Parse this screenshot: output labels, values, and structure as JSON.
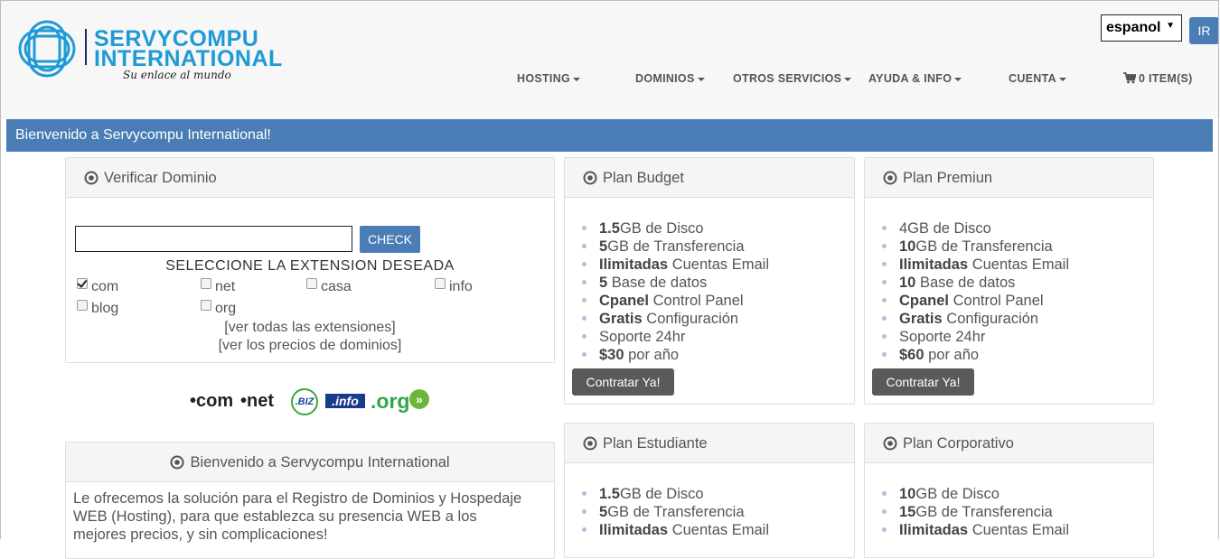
{
  "brand": {
    "line1": "SERVYCOMPU",
    "line2": "INTERNATIONAL",
    "tagline": "Su enlace al mundo",
    "color": "#1e9ad6"
  },
  "language": {
    "selected": "espanol",
    "go_label": "IR"
  },
  "nav": [
    {
      "label": "HOSTING"
    },
    {
      "label": "DOMINIOS"
    },
    {
      "label": "OTROS SERVICIOS"
    },
    {
      "label": "AYUDA & INFO"
    },
    {
      "label": "CUENTA"
    }
  ],
  "cart": {
    "label": "0 ITEM(S)",
    "icon": "cart-icon"
  },
  "welcome_bar": "Bienvenido a Servycompu International!",
  "domain_panel": {
    "title": "Verificar Dominio",
    "input_value": "",
    "check_label": "CHECK",
    "extension_title": "SELECCIONE LA EXTENSION DESEADA",
    "extensions": [
      {
        "label": "com",
        "checked": true
      },
      {
        "label": "net",
        "checked": false
      },
      {
        "label": "casa",
        "checked": false
      },
      {
        "label": "info",
        "checked": false
      },
      {
        "label": "blog",
        "checked": false
      },
      {
        "label": "org",
        "checked": false
      }
    ],
    "link_all": "[ver todas las extensiones]",
    "link_prices": "[ver los precios de dominios]"
  },
  "tld_logos": {
    "com": "•com",
    "net": "•net",
    "biz": ".BIZ",
    "info": ".info",
    "org": ".org"
  },
  "intro_panel": {
    "title": "Bienvenido a Servycompu International",
    "text": "Le ofrecemos la solución para el Registro de Dominios y Hospedaje WEB (Hosting), para que establezca su presencia WEB a los mejores precios, y sin complicaciones!"
  },
  "plans": [
    {
      "title": "Plan Budget",
      "features": [
        {
          "strong": "1.5",
          "rest": "GB de Disco"
        },
        {
          "strong": "5",
          "rest": "GB de Transferencia"
        },
        {
          "strong": "Ilimitadas",
          "rest": " Cuentas Email"
        },
        {
          "strong": "5",
          "rest": " Base de datos"
        },
        {
          "strong": "Cpanel",
          "rest": " Control Panel"
        },
        {
          "strong": "Gratis",
          "rest": " Configuración"
        },
        {
          "strong": "",
          "rest": "Soporte 24hr"
        },
        {
          "strong": "$30",
          "rest": " por año"
        }
      ],
      "button": "Contratar Ya!"
    },
    {
      "title": "Plan Premiun",
      "features": [
        {
          "strong": "",
          "rest": "4GB de Disco"
        },
        {
          "strong": "10",
          "rest": "GB de Transferencia"
        },
        {
          "strong": "Ilimitadas",
          "rest": " Cuentas Email"
        },
        {
          "strong": "10",
          "rest": " Base de datos"
        },
        {
          "strong": "Cpanel",
          "rest": " Control Panel"
        },
        {
          "strong": "Gratis",
          "rest": " Configuración"
        },
        {
          "strong": "",
          "rest": "Soporte 24hr"
        },
        {
          "strong": "$60",
          "rest": " por año"
        }
      ],
      "button": "Contratar Ya!"
    },
    {
      "title": "Plan Estudiante",
      "features": [
        {
          "strong": "1.5",
          "rest": "GB de Disco"
        },
        {
          "strong": "5",
          "rest": "GB de Transferencia"
        },
        {
          "strong": "Ilimitadas",
          "rest": " Cuentas Email"
        }
      ]
    },
    {
      "title": "Plan Corporativo",
      "features": [
        {
          "strong": "10",
          "rest": "GB de Disco"
        },
        {
          "strong": "15",
          "rest": "GB de Transferencia"
        },
        {
          "strong": "Ilimitadas",
          "rest": " Cuentas Email"
        }
      ]
    }
  ]
}
